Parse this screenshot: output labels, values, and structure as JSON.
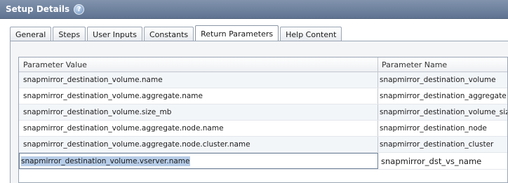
{
  "header": {
    "title": "Setup Details",
    "help_icon": "question-icon"
  },
  "tabs": [
    {
      "label": "General",
      "active": false
    },
    {
      "label": "Steps",
      "active": false
    },
    {
      "label": "User Inputs",
      "active": false
    },
    {
      "label": "Constants",
      "active": false
    },
    {
      "label": "Return Parameters",
      "active": true
    },
    {
      "label": "Help Content",
      "active": false
    }
  ],
  "table": {
    "columns": [
      "Parameter Value",
      "Parameter Name"
    ],
    "rows": [
      {
        "value": "snapmirror_destination_volume.name",
        "name": "snapmirror_destination_volume"
      },
      {
        "value": "snapmirror_destination_volume.aggregate.name",
        "name": "snapmirror_destination_aggregate"
      },
      {
        "value": "snapmirror_destination_volume.size_mb",
        "name": "snapmirror_destination_volume_size_m"
      },
      {
        "value": "snapmirror_destination_volume.aggregate.node.name",
        "name": "snapmirror_destination_node"
      },
      {
        "value": "snapmirror_destination_volume.aggregate.node.cluster.name",
        "name": "snapmirror_destination_cluster"
      }
    ],
    "editing_row": {
      "value": "snapmirror_destination_volume.vserver.name",
      "name": "snapmirror_dst_vs_name"
    }
  }
}
